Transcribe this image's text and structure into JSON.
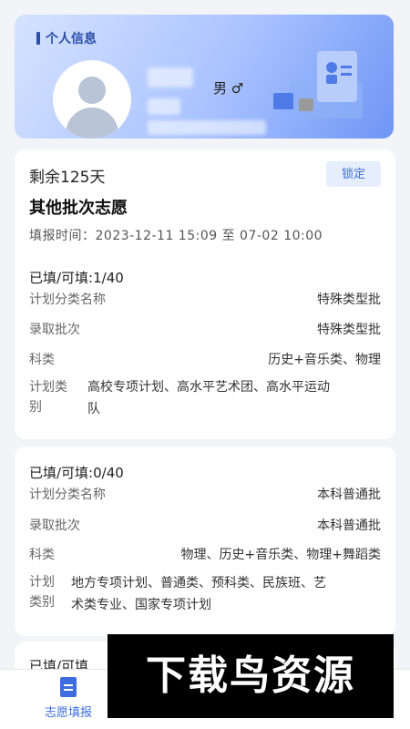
{
  "profile": {
    "heading": "个人信息",
    "gender": "男 ♂"
  },
  "card1": {
    "remaining": "剩余125天",
    "lock_label": "锁定",
    "title": "其他批次志愿",
    "fill_time": "填报时间：2023-12-11 15:09 至 07-02 10:00",
    "filled": "已填/可填:1/40",
    "plan_name_label": "计划分类名称",
    "plan_name_value": "特殊类型批",
    "admission_label": "录取批次",
    "admission_value": "特殊类型批",
    "subject_label": "科类",
    "subject_value": "历史+音乐类、物理",
    "plan_type_label_1": "计划类",
    "plan_type_label_2": "别",
    "plan_type_value_1": "高校专项计划、高水平艺术团、高水平运动",
    "plan_type_value_2": "队"
  },
  "card2": {
    "filled": "已填/可填:0/40",
    "plan_name_label": "计划分类名称",
    "plan_name_value": "本科普通批",
    "admission_label": "录取批次",
    "admission_value": "本科普通批",
    "subject_label": "科类",
    "subject_value": "物理、历史+音乐类、物理+舞蹈类",
    "plan_type_label_1": "计划",
    "plan_type_label_2": "类别",
    "plan_type_value_1": "地方专项计划、普通类、预科类、民族班、艺",
    "plan_type_value_2": "术类专业、国家专项计划"
  },
  "card3": {
    "filled": "已填/可填"
  },
  "nav": {
    "label": "志愿填报"
  },
  "watermark": {
    "text": "下载鸟资源"
  }
}
